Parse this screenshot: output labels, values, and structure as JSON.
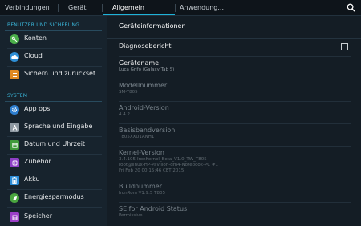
{
  "tabs": [
    {
      "label": "Verbindungen"
    },
    {
      "label": "Gerät"
    },
    {
      "label": "Allgemein"
    },
    {
      "label": "Anwendung..."
    }
  ],
  "sidebar": {
    "section_user": "BENUTZER UND SICHERUNG",
    "section_system": "SYSTEM",
    "items": [
      {
        "label": "Konten",
        "icon": "key-icon",
        "color": "#4bb04a"
      },
      {
        "label": "Cloud",
        "icon": "cloud-icon",
        "color": "#2e8fd6"
      },
      {
        "label": "Sichern und zurückset...",
        "icon": "backup-icon",
        "color": "#e08a22"
      },
      {
        "label": "App ops",
        "icon": "gear-icon",
        "color": "#2e7fd0"
      },
      {
        "label": "Sprache und Eingabe",
        "icon": "language-icon",
        "color": "#8f9aa3"
      },
      {
        "label": "Datum und Uhrzeit",
        "icon": "calendar-icon",
        "color": "#3f9a3a"
      },
      {
        "label": "Zubehör",
        "icon": "accessory-icon",
        "color": "#8e3fc6"
      },
      {
        "label": "Akku",
        "icon": "battery-icon",
        "color": "#2a8bd6"
      },
      {
        "label": "Energiesparmodus",
        "icon": "power-saving-icon",
        "color": "#4aa63f"
      },
      {
        "label": "Speicher",
        "icon": "storage-icon",
        "color": "#9b3fc7"
      }
    ]
  },
  "content": {
    "title": "Geräteinformationen",
    "diagnose": "Diagnosebericht",
    "devicename_label": "Gerätename",
    "devicename_value": "Luca Grifo (Galaxy Tab S)",
    "model_label": "Modellnummer",
    "model_value": "SM-T805",
    "android_label": "Android-Version",
    "android_value": "4.4.2",
    "baseband_label": "Basisbandversion",
    "baseband_value": "T805XXU1ANH1",
    "kernel_label": "Kernel-Version",
    "kernel_value_1": "3.4.105-IronKernel_Beta_V1.0_TW_T805",
    "kernel_value_2": "root@linux-HP-Pavilion-dm4-Notebook-PC #1",
    "kernel_value_3": "Fri Feb 20 00:15:46 CET 2015",
    "build_label": "Buildnummer",
    "build_value": "IronRom V1.9.5 T805",
    "se_label": "SE for Android Status",
    "se_value": "Permissive"
  }
}
